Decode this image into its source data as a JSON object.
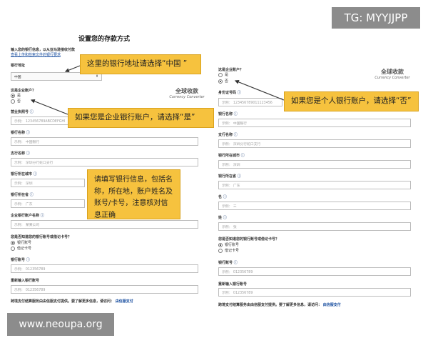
{
  "watermark": {
    "tg": "TG: MYYJJPP",
    "site": "www.neoupa.org"
  },
  "page_title": "设置您的存款方式",
  "logo": {
    "cn": "全球收款",
    "en": "Currency Converter"
  },
  "left_form": {
    "intro": "输入您的银行信息，以从亚马逊接收付款",
    "intro_link": "查看上传和检索文件的银行要求",
    "bank_location_label": "银行地址",
    "bank_location_value": "中国",
    "enterprise_label": "这是企业账户？",
    "opt_yes": "是",
    "opt_no": "否",
    "license_label": "营业执照号",
    "license_placeholder": "示例： 123456789ABCDEFGHI",
    "bank_name_label": "银行名称",
    "bank_name_placeholder": "示例： 中国银行",
    "branch_label": "支行名称",
    "branch_placeholder": "示例： 深圳分行蛇口支行",
    "city_label": "银行所在城市",
    "city_placeholder": "示例： 深圳",
    "province_label": "银行所在省",
    "province_placeholder": "示例： 广东",
    "holder_label": "企业银行账户名称",
    "holder_placeholder": "示例： 某某公司",
    "type_question": "您是否知道您的银行账号或借记卡号？",
    "opt_account": "银行账号",
    "opt_debit": "借记卡号",
    "account_label": "银行账号",
    "account_placeholder": "示例： 012356789",
    "reenter_label": "重新输入银行账号",
    "reenter_placeholder": "示例： 012356789",
    "footer_text": "跨境支付结算服务由由信服支付提供。要了解更多信息，请访问：",
    "footer_link": "由信服支付"
  },
  "right_form": {
    "enterprise_label": "这是企业账户？",
    "opt_yes": "是",
    "opt_no": "否",
    "id_label": "身份证号码",
    "id_placeholder": "示例： 123456789011123456",
    "bank_name_label": "银行名称",
    "bank_name_placeholder": "示例： 中国银行",
    "branch_label": "支行名称",
    "branch_placeholder": "示例： 深圳分行蛇口支行",
    "city_label": "银行所在城市",
    "city_placeholder": "示例： 深圳",
    "province_label": "银行所在省",
    "province_placeholder": "示例： 广东",
    "first_name_label": "名",
    "first_name_placeholder": "示例： 三",
    "last_name_label": "姓",
    "last_name_placeholder": "示例： 张",
    "type_question": "您是否知道您的银行账号或借记卡号？",
    "opt_account": "银行账号",
    "opt_debit": "借记卡号",
    "account_label": "银行账号",
    "account_placeholder": "示例： 012356789",
    "reenter_label": "重新输入银行账号",
    "reenter_placeholder": "示例： 012356789",
    "footer_text": "跨境支付结算服务由由信服支付提供。要了解更多信息，请访问：",
    "footer_link": "由信服支付"
  },
  "notes": {
    "n1": "这里的银行地址请选择“中国 ”",
    "n2": "如果您是企业银行账户，请选择“是”",
    "n3": "请填写银行信息，包括名称，所在地，账户姓名及账号/卡号，注意核对信息正确",
    "n4": "如果您是个人银行账户，请选择“否”"
  },
  "colors": {
    "note_bg": "#f6c23e",
    "watermark_bg": "#8c8c8c",
    "link": "#1a4fa0"
  }
}
